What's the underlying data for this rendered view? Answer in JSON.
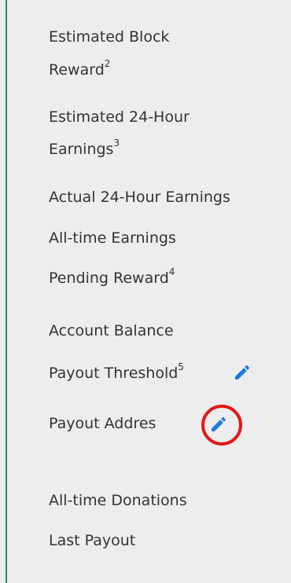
{
  "labels": {
    "estimated_block_reward_line1": "Estimated Block",
    "estimated_block_reward_line2": "Reward",
    "estimated_block_reward_sup": "2",
    "estimated_24h_earnings_line1": "Estimated 24-Hour",
    "estimated_24h_earnings_line2": "Earnings",
    "estimated_24h_earnings_sup": "3",
    "actual_24h_earnings": "Actual 24-Hour Earnings",
    "all_time_earnings": "All-time Earnings",
    "pending_reward": "Pending Reward",
    "pending_reward_sup": "4",
    "account_balance": "Account Balance",
    "payout_threshold": "Payout Threshold",
    "payout_threshold_sup": "5",
    "payout_address": "Payout Addres",
    "all_time_donations": "All-time Donations",
    "last_payout": "Last Payout"
  },
  "icons": {
    "edit_icon_name": "pencil-icon",
    "edit_icon_color": "#1f7ae0",
    "highlight_circle_color": "#e11919",
    "left_rule_color": "#2e8b57"
  }
}
